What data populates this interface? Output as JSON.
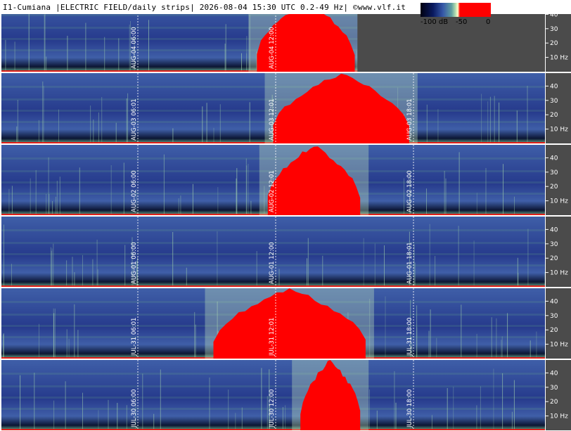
{
  "header": {
    "title": "I1-Cumiana |ELECTRIC FIELD/daily strips| 2026-08-04 15:30 UTC 0.2-49 Hz| ©www.vlf.it",
    "scale": {
      "min_label": "-100 dB",
      "mid_label": "-50",
      "max_label": "0"
    }
  },
  "colors": {
    "background_low": "#263a8c",
    "background_mid": "#3f5fa8",
    "green": "#6aaa88",
    "saturation": "#ff0000",
    "panel": "#4b4b4b"
  },
  "chart_data": {
    "type": "heatmap",
    "title": "I1-Cumiana |ELECTRIC FIELD/daily strips| 2026-08-04 15:30 UTC 0.2-49 Hz| ©www.vlf.it",
    "ylabel": "Hz",
    "ylim": [
      0,
      49
    ],
    "yticks": [
      "40",
      "30",
      "20",
      "10 Hz"
    ],
    "colorbar": {
      "min": "-100 dB",
      "mid": "-50",
      "max": "0"
    },
    "strips": [
      {
        "date": "AUG-04",
        "time_labels": [
          "AUG-04 06:00",
          "AUG-04 12:00"
        ],
        "red_spans": [
          [
            0.47,
            0.65
          ]
        ],
        "partial": true
      },
      {
        "date": "AUG-03",
        "time_labels": [
          "AUG-03 06:01",
          "AUG-03 12:01",
          "AUG-03 18:01"
        ],
        "red_spans": [
          [
            0.5,
            0.75
          ]
        ],
        "partial": false
      },
      {
        "date": "AUG-02",
        "time_labels": [
          "AUG-02 06:00",
          "AUG-02 12:01",
          "AUG-02 18:00"
        ],
        "red_spans": [
          [
            0.49,
            0.66
          ]
        ],
        "partial": false
      },
      {
        "date": "AUG-01",
        "time_labels": [
          "AUG-01 06:00",
          "AUG-01 12:00",
          "AUG-01 18:01"
        ],
        "red_spans": [],
        "partial": false
      },
      {
        "date": "JUL-31",
        "time_labels": [
          "JUL-31 06:01",
          "JUL-31 12:01",
          "JUL-31 18:00"
        ],
        "red_spans": [
          [
            0.39,
            0.67
          ]
        ],
        "partial": false
      },
      {
        "date": "JUL-30",
        "time_labels": [
          "JUL-30 06:00",
          "JUL-30 12:00",
          "JUL-30 18:00"
        ],
        "red_spans": [
          [
            0.55,
            0.66
          ]
        ],
        "partial": false
      }
    ]
  }
}
